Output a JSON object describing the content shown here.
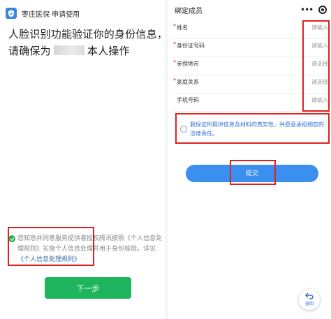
{
  "left": {
    "app_name": "枣庄医保 申请使用",
    "title_line1": "人脸识别功能验证你的身份信息，",
    "title_line2_prefix": "请确保为",
    "title_line2_suffix": "本人操作",
    "consent_text": "您知悉并同意服务提供者授权腾讯按照《个人信息处理规则》实施个人信息处理并用于身份核验。详见",
    "consent_link": "《个人信息处理规则》",
    "next_button": "下一步"
  },
  "right": {
    "nav_title": "绑定成员",
    "fields": [
      {
        "label": "姓名",
        "required": true,
        "hint": "请输入"
      },
      {
        "label": "身份证号码",
        "required": true,
        "hint": "请输入"
      },
      {
        "label": "参保地市",
        "required": true,
        "hint": "请选择"
      },
      {
        "label": "家庭关系",
        "required": true,
        "hint": "请选择"
      },
      {
        "label": "手机号码",
        "required": false,
        "hint": "请输入"
      }
    ],
    "guarantee_text": "我保证所提供信息及材料的真实性，并愿意承担相应的法律责任。",
    "submit_button": "提交",
    "back_label": "返回"
  },
  "colors": {
    "green_button": "#1eb55d",
    "blue_button": "#3b8fee",
    "annotation_red": "#e02020",
    "required_star": "#e02020",
    "guarantee_text": "#2c6fd6"
  },
  "icons": {
    "app_logo": "shield-logo-icon",
    "consent_check": "check-circle-icon",
    "more": "more-dots-icon",
    "close_target": "target-icon",
    "radio": "radio-circle-icon",
    "back": "back-arrow-icon"
  }
}
